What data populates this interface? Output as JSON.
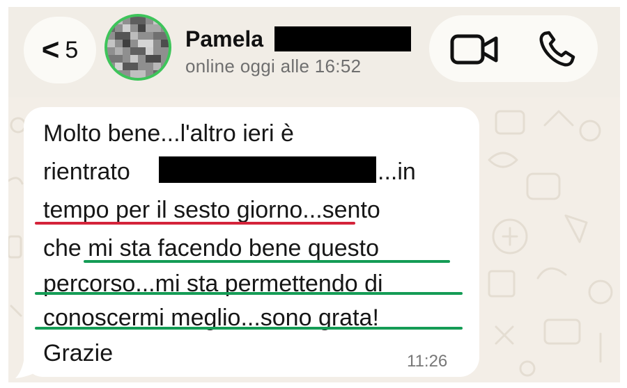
{
  "header": {
    "back_chevron": "<",
    "back_count": "5",
    "contact_name": "Pamela",
    "status": "online oggi alle 16:52",
    "icons": [
      "back-chevron-icon",
      "video-call-icon",
      "phone-call-icon"
    ]
  },
  "message": {
    "lines": [
      "Molto bene...l'altro ieri è",
      "rientrato",
      "...in",
      "tempo per il sesto giorno...sento",
      "che mi sta facendo bene questo",
      "percorso...mi sta permettendo di",
      "conoscermi meglio...sono grata!",
      "Grazie"
    ],
    "time": "11:26"
  },
  "colors": {
    "online_ring": "#3ec45a",
    "underline_red": "#d4233a",
    "underline_green": "#149c55",
    "bubble": "#ffffff",
    "chat_background": "#f3eee7"
  }
}
